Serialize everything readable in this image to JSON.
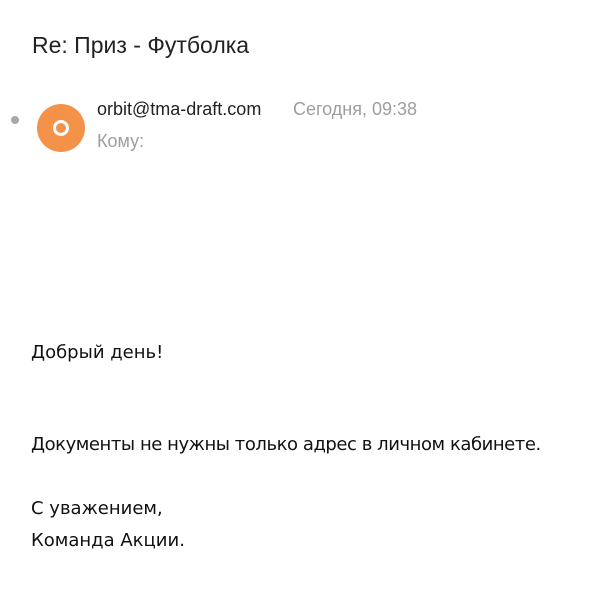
{
  "email": {
    "subject": "Re: Приз - Футболка",
    "sender": "orbit@tma-draft.com",
    "date": "Сегодня, 09:38",
    "to_label": "Кому:",
    "avatar": {
      "letter_icon": "circle-o-icon",
      "color": "#f5924a"
    },
    "unread_dot_color": "#a8a8a8",
    "body": {
      "greeting": "Добрый день!",
      "main": "Документы не нужны только адрес в личном кабинете.",
      "regards": "С уважением,",
      "signature": "Команда Акции."
    }
  }
}
